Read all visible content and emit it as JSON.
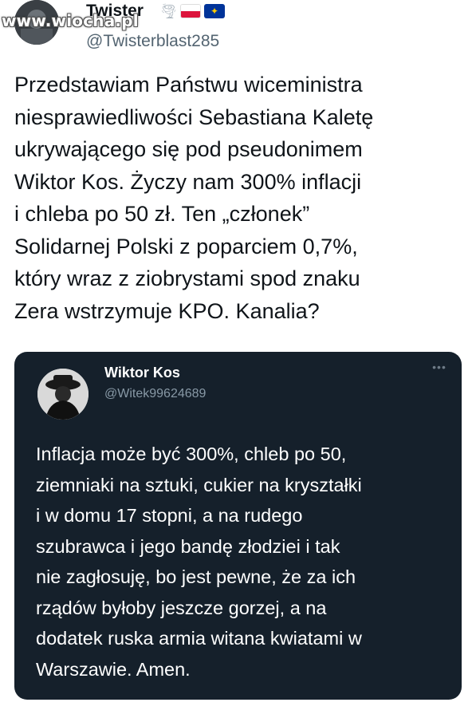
{
  "watermark": "www.wiocha.pl",
  "outer_tweet": {
    "display_name": "Twister",
    "handle": "@Twisterblast285",
    "icons": [
      "tornado-icon",
      "flag-poland-icon",
      "flag-eu-icon"
    ],
    "text_lines": [
      "Przedstawiam Państwu wiceministra",
      "niesprawiedliwości Sebastiana Kaletę",
      "ukrywającego się pod pseudonimem",
      "Wiktor Kos. Życzy nam 300% inflacji",
      "i chleba po 50 zł. Ten „członek”",
      "Solidarnej Polski z poparciem 0,7%,",
      "który wraz z ziobrystami spod znaku",
      "Zera wstrzymuje KPO. Kanalia?"
    ]
  },
  "embedded_tweet": {
    "display_name": "Wiktor Kos",
    "handle": "@Witek99624689",
    "more_icon": "more-horizontal-icon",
    "text_lines": [
      "Inflacja może być 300%, chleb po 50,",
      "ziemniaki na sztuki, cukier na kryształki",
      "i w domu 17 stopni, a na rudego",
      "szubrawca i jego bandę złodziei i tak",
      "nie zagłosuję, bo jest pewne, że za ich",
      "rządów byłoby jeszcze gorzej, a na",
      "dodatek ruska armia witana kwiatami w",
      "Warszawie. Amen."
    ]
  },
  "colors": {
    "card_background": "#15202b",
    "handle_gray": "#536471",
    "inner_handle_gray": "#8899a6"
  }
}
